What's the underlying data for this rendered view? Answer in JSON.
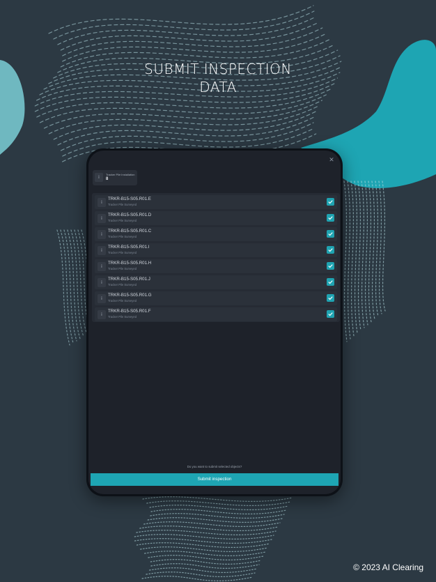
{
  "headline": {
    "line1": "SUBMIT INSPECTION",
    "line2": "DATA"
  },
  "copyright": "© 2023 AI Clearing",
  "colors": {
    "background": "#2c3943",
    "accent": "#1ea5b3",
    "shape_light": "#6fb8c0",
    "dots": "#b7dfe4"
  },
  "dialog": {
    "close_icon": "close-icon",
    "summary": {
      "label": "Tracker Pile Installation",
      "value": "8",
      "icon": "info-icon"
    },
    "objects": [
      {
        "id": "TRKR-B15-S05.R01.E",
        "subtitle": "Tracker Pile Surveyed",
        "checked": true,
        "icon": "info-icon"
      },
      {
        "id": "TRKR-B15-S05.R01.D",
        "subtitle": "Tracker Pile Surveyed",
        "checked": true,
        "icon": "info-icon"
      },
      {
        "id": "TRKR-B15-S05.R01.C",
        "subtitle": "Tracker Pile Surveyed",
        "checked": true,
        "icon": "info-icon"
      },
      {
        "id": "TRKR-B15-S05.R01.I",
        "subtitle": "Tracker Pile Surveyed",
        "checked": true,
        "icon": "info-icon"
      },
      {
        "id": "TRKR-B15-S05.R01.H",
        "subtitle": "Tracker Pile Surveyed",
        "checked": true,
        "icon": "info-icon"
      },
      {
        "id": "TRKR-B15-S05.R01.J",
        "subtitle": "Tracker Pile Surveyed",
        "checked": true,
        "icon": "info-icon"
      },
      {
        "id": "TRKR-B15-S05.R01.G",
        "subtitle": "Tracker Pile Surveyed",
        "checked": true,
        "icon": "info-icon"
      },
      {
        "id": "TRKR-B15-S05.R01.F",
        "subtitle": "Tracker Pile Surveyed",
        "checked": true,
        "icon": "info-icon"
      }
    ],
    "prompt": "Do you want to submit selected objects?",
    "submit_label": "Submit inspection"
  }
}
